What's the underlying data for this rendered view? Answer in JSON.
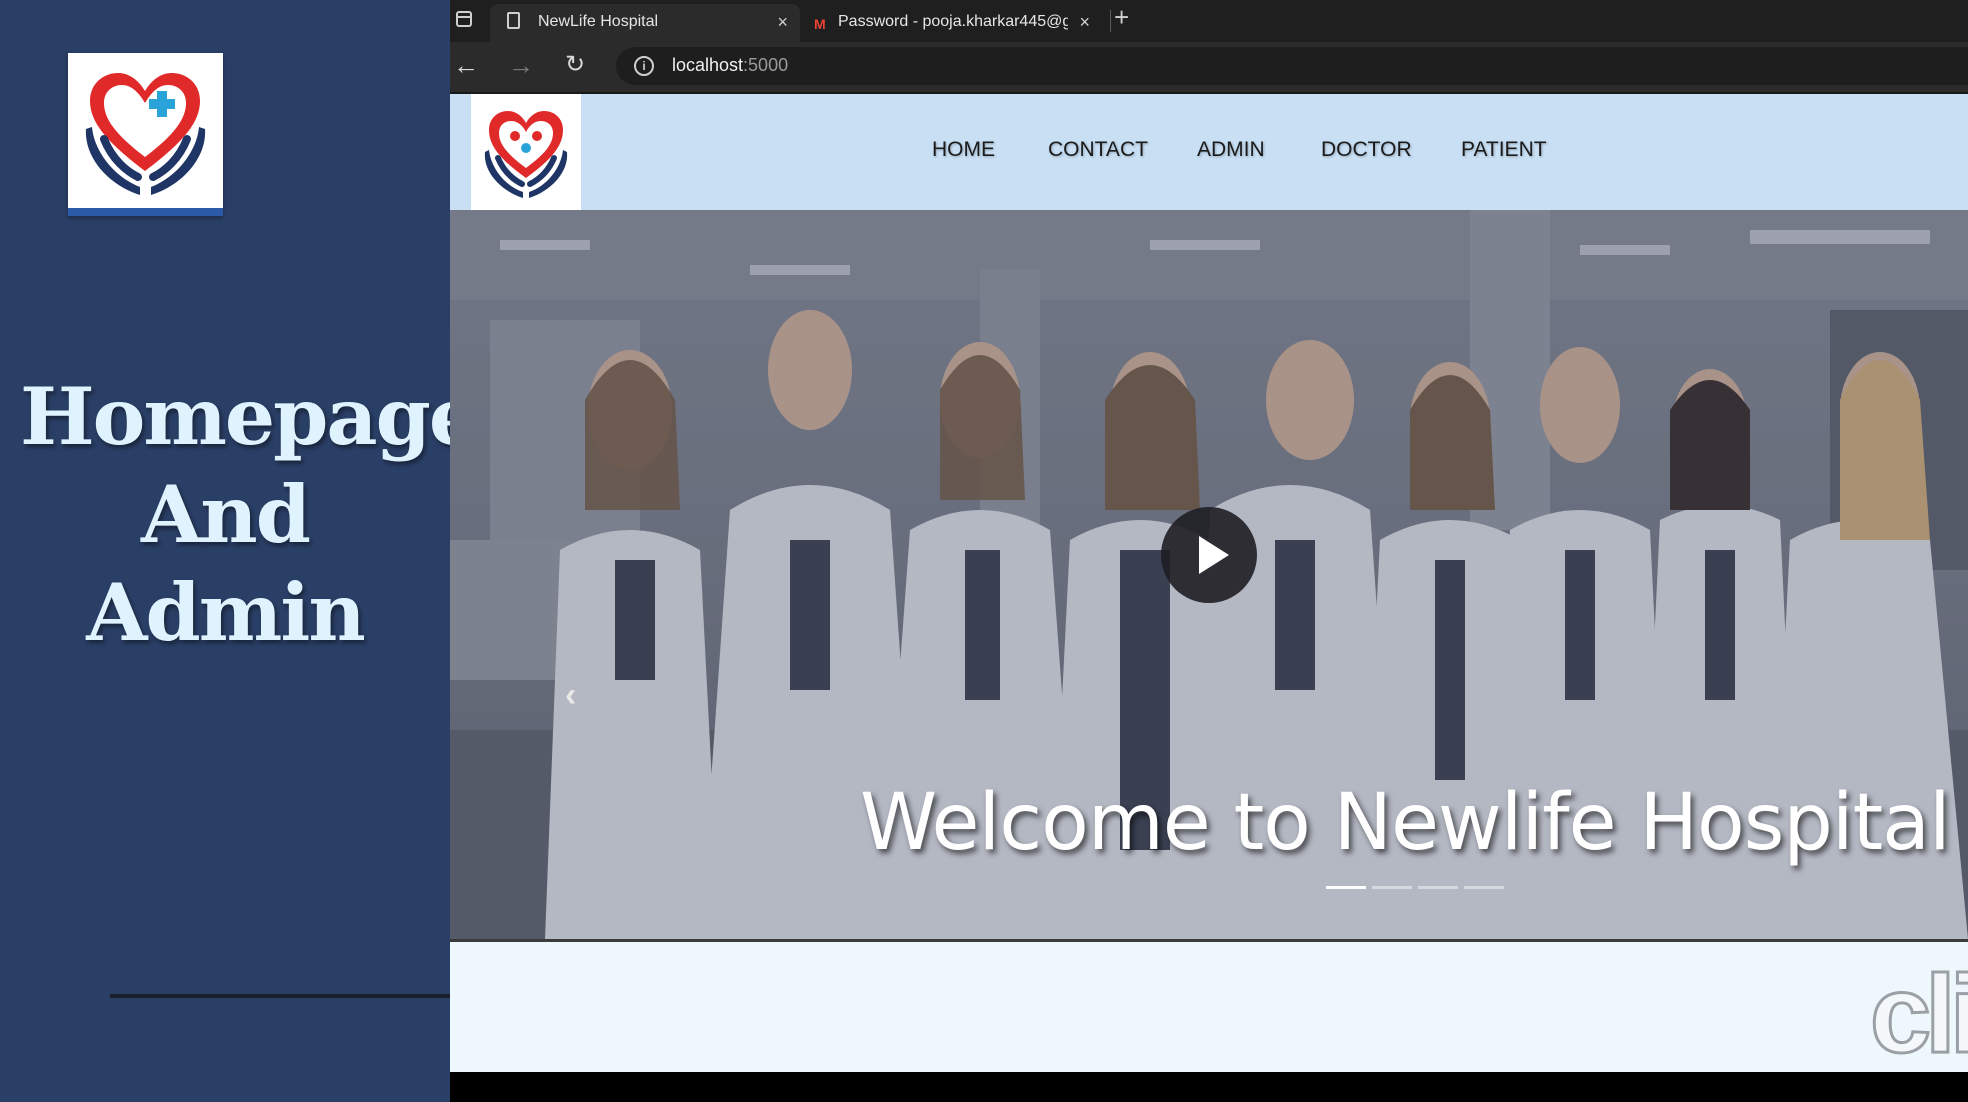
{
  "slide": {
    "title_lines": [
      "Homepage",
      "And",
      "Admin"
    ]
  },
  "browser": {
    "tabs": [
      {
        "label": "NewLife Hospital",
        "icon": "page-icon",
        "active": true
      },
      {
        "label": "Password - pooja.kharkar445@g",
        "icon": "gmail-icon",
        "active": false
      }
    ],
    "close_glyph": "×",
    "new_tab_glyph": "+",
    "address": {
      "host": "localhost",
      "port": ":5000"
    }
  },
  "site": {
    "nav": [
      "HOME",
      "CONTACT",
      "ADMIN",
      "DOCTOR",
      "PATIENT"
    ],
    "hero": {
      "caption": "Welcome to Newlife Hospital",
      "slides_count": 4,
      "active_slide": 1,
      "prev_glyph": "‹"
    },
    "watermark": "cli"
  },
  "colors": {
    "slide_bg": "#2a3f66",
    "slide_title": "#dff3ff",
    "site_header": "#c8dff4",
    "logo_red": "#e02a2a",
    "logo_navy": "#1f3566",
    "logo_blue": "#2aa3d8"
  }
}
